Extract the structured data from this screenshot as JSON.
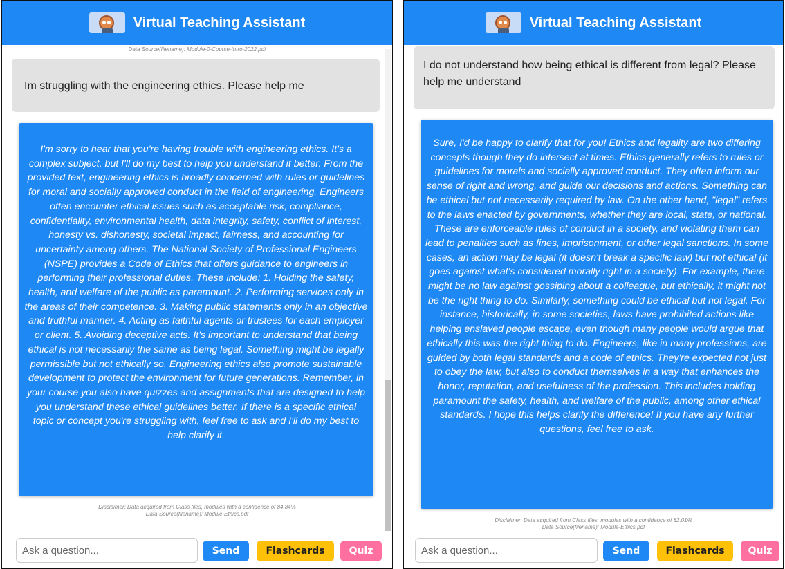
{
  "colors": {
    "header": "#1e88f5",
    "bot_bubble": "#1e88f5",
    "user_bubble": "#e2e2e2",
    "send_button": "#1e88f5",
    "flashcards_button": "#ffc107",
    "quiz_button": "#ff6fa0"
  },
  "left": {
    "header": {
      "logo_icon": "robot-avatar-icon",
      "title": "Virtual Teaching Assistant"
    },
    "source_top": "Data Source(filename): Module-0-Course-Intro-2022.pdf",
    "user_message": "Im struggling with the engineering ethics. Please help me",
    "bot_message": "I'm sorry to hear that you're having trouble with engineering ethics. It's a complex subject, but I'll do my best to help you understand it better. From the provided text, engineering ethics is broadly concerned with rules or guidelines for moral and socially approved conduct in the field of engineering. Engineers often encounter ethical issues such as acceptable risk, compliance, confidentiality, environmental health, data integrity, safety, conflict of interest, honesty vs. dishonesty, societal impact, fairness, and accounting for uncertainty among others. The National Society of Professional Engineers (NSPE) provides a Code of Ethics that offers guidance to engineers in performing their professional duties. These include: 1. Holding the safety, health, and welfare of the public as paramount. 2. Performing services only in the areas of their competence. 3. Making public statements only in an objective and truthful manner. 4. Acting as faithful agents or trustees for each employer or client. 5. Avoiding deceptive acts. It's important to understand that being ethical is not necessarily the same as being legal. Something might be legally permissible but not ethically so. Engineering ethics also promote sustainable development to protect the environment for future generations. Remember, in your course you also have quizzes and assignments that are designed to help you understand these ethical guidelines better. If there is a specific ethical topic or concept you're struggling with, feel free to ask and I'll do my best to help clarify it.",
    "disclaimer": "Disclaimer: Data acquired from Class files, modules with a confidence of 84.84%",
    "source_bottom": "Data Source(filename): Module-Ethics.pdf",
    "input_placeholder": "Ask a question...",
    "send_label": "Send",
    "flashcards_label": "Flashcards",
    "quiz_label": "Quiz"
  },
  "right": {
    "header": {
      "logo_icon": "robot-avatar-icon",
      "title": "Virtual Teaching Assistant"
    },
    "user_message": "I do not understand how being ethical is different from legal? Please help me understand",
    "bot_message": "Sure, I'd be happy to clarify that for you! Ethics and legality are two differing concepts though they do intersect at times. Ethics generally refers to rules or guidelines for morals and socially approved conduct. They often inform our sense of right and wrong, and guide our decisions and actions. Something can be ethical but not necessarily required by law. On the other hand, \"legal\" refers to the laws enacted by governments, whether they are local, state, or national. These are enforceable rules of conduct in a society, and violating them can lead to penalties such as fines, imprisonment, or other legal sanctions. In some cases, an action may be legal (it doesn't break a specific law) but not ethical (it goes against what's considered morally right in a society). For example, there might be no law against gossiping about a colleague, but ethically, it might not be the right thing to do. Similarly, something could be ethical but not legal. For instance, historically, in some societies, laws have prohibited actions like helping enslaved people escape, even though many people would argue that ethically this was the right thing to do. Engineers, like in many professions, are guided by both legal standards and a code of ethics. They're expected not just to obey the law, but also to conduct themselves in a way that enhances the honor, reputation, and usefulness of the profession. This includes holding paramount the safety, health, and welfare of the public, among other ethical standards. I hope this helps clarify the difference! If you have any further questions, feel free to ask.",
    "disclaimer": "Disclaimer: Data acquired from Class files, modules with a confidence of 82.01%",
    "source_bottom": "Data Source(filename): Module-Ethics.pdf",
    "input_placeholder": "Ask a question...",
    "send_label": "Send",
    "flashcards_label": "Flashcards",
    "quiz_label": "Quiz"
  }
}
